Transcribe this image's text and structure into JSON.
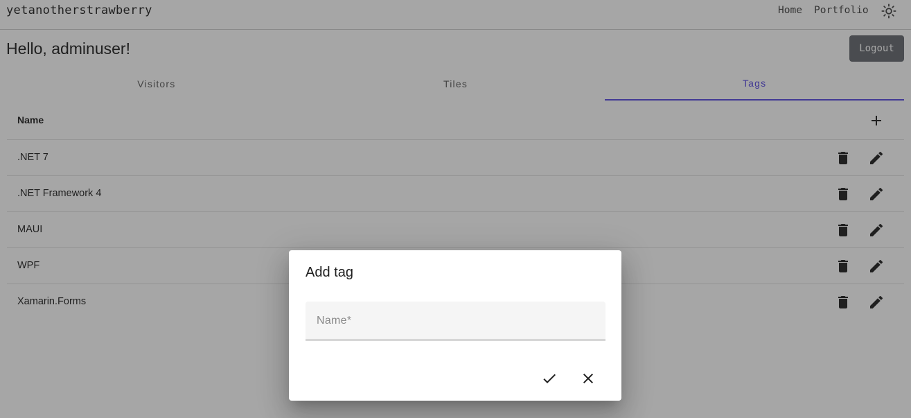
{
  "header": {
    "brand": "yetanotherstrawberry",
    "nav": {
      "home": "Home",
      "portfolio": "Portfolio"
    },
    "theme_icon": "sun-icon"
  },
  "greeting": "Hello, adminuser!",
  "logout_label": "Logout",
  "tabs": [
    {
      "label": "Visitors",
      "active": false
    },
    {
      "label": "Tiles",
      "active": false
    },
    {
      "label": "Tags",
      "active": true
    }
  ],
  "table": {
    "column_name": "Name",
    "add_icon": "plus-icon",
    "rows": [
      {
        "name": ".NET 7"
      },
      {
        "name": ".NET Framework 4"
      },
      {
        "name": "MAUI"
      },
      {
        "name": "WPF"
      },
      {
        "name": "Xamarin.Forms"
      }
    ],
    "row_actions": {
      "delete_icon": "trash-icon",
      "edit_icon": "pencil-icon"
    }
  },
  "dialog": {
    "title": "Add tag",
    "name_field": {
      "value": "",
      "placeholder": "Name*"
    },
    "confirm_icon": "check-icon",
    "cancel_icon": "close-icon"
  },
  "colors": {
    "accent": "#594ae2",
    "logout_bg": "#666a70",
    "overlay": "rgba(33,33,33,0.40)"
  }
}
